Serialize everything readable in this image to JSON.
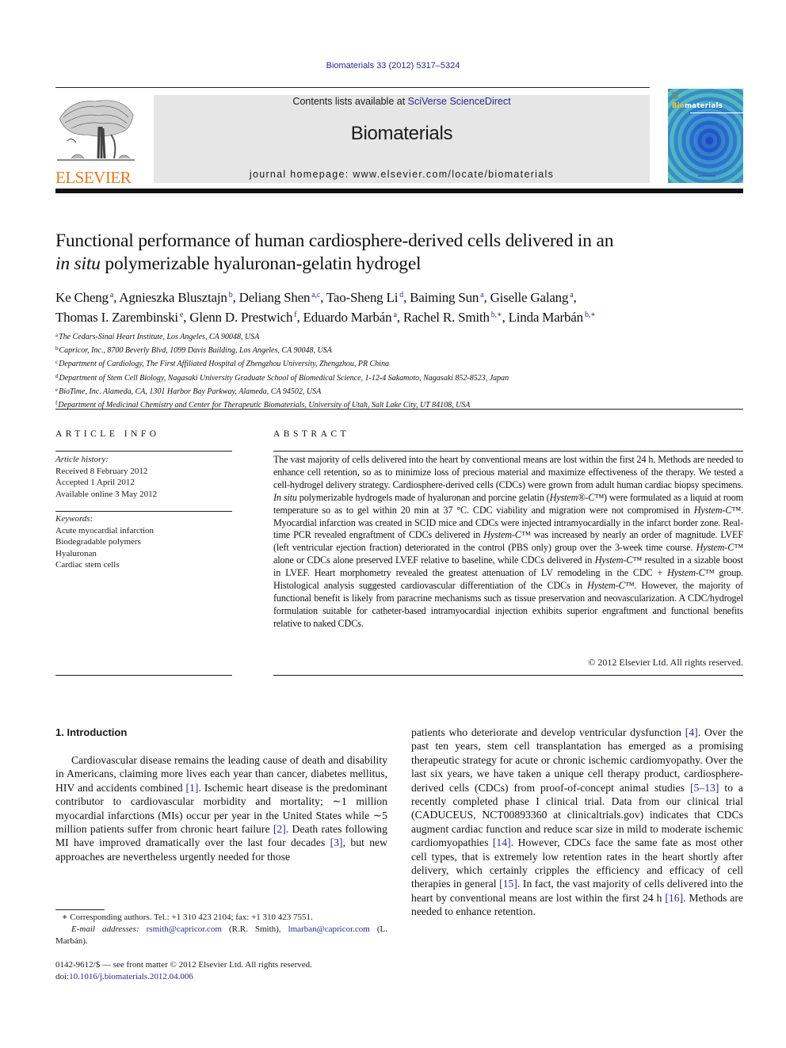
{
  "header": {
    "citation": "Biomaterials 33 (2012) 5317–5324",
    "contents_prefix": "Contents lists available at ",
    "contents_link": "SciVerse ScienceDirect",
    "journal_name": "Biomaterials",
    "homepage_prefix": "journal homepage: ",
    "homepage_url": "www.elsevier.com/locate/biomaterials",
    "publisher_logo_text": "ELSEVIER",
    "cover_title_highlight": "Bio",
    "cover_title_rest": "materials",
    "colors": {
      "publisher_orange": "#e87722",
      "link_blue": "#2a2a8a",
      "header_gray": "#e6e6e6"
    }
  },
  "article": {
    "title_line1": "Functional performance of human cardiosphere-derived cells delivered in an",
    "title_italic": "in situ",
    "title_line2_rest": " polymerizable hyaluronan-gelatin hydrogel",
    "authors": [
      {
        "name": "Ke Cheng",
        "sup": "a"
      },
      {
        "name": "Agnieszka Blusztajn",
        "sup": "b"
      },
      {
        "name": "Deliang Shen",
        "sup": "a,c"
      },
      {
        "name": "Tao-Sheng Li",
        "sup": "d"
      },
      {
        "name": "Baiming Sun",
        "sup": "a"
      },
      {
        "name": "Giselle Galang",
        "sup": "a"
      },
      {
        "name": "Thomas I. Zarembinski",
        "sup": "e"
      },
      {
        "name": "Glenn D. Prestwich",
        "sup": "f"
      },
      {
        "name": "Eduardo Marbán",
        "sup": "a"
      },
      {
        "name": "Rachel R. Smith",
        "sup": "b,∗"
      },
      {
        "name": "Linda Marbán",
        "sup": "b,∗"
      }
    ],
    "affiliations": [
      {
        "key": "a",
        "text": "The Cedars-Sinai Heart Institute, Los Angeles, CA 90048, USA"
      },
      {
        "key": "b",
        "text": "Capricor, Inc., 8700 Beverly Blvd, 1099 Davis Building, Los Angeles, CA 90048, USA"
      },
      {
        "key": "c",
        "text": "Department of Cardiology, The First Affiliated Hospital of Zhengzhou University, Zhengzhou, PR China"
      },
      {
        "key": "d",
        "text": "Department of Stem Cell Biology, Nagasaki University Graduate School of Biomedical Science, 1-12-4 Sakamoto, Nagasaki 852-8523, Japan"
      },
      {
        "key": "e",
        "text": "BioTime, Inc. Alameda, CA, 1301 Harbor Bay Parkway, Alameda, CA 94502, USA"
      },
      {
        "key": "f",
        "text": "Department of Medicinal Chemistry and Center for Therapeutic Biomaterials, University of Utah, Salt Lake City, UT 84108, USA"
      }
    ]
  },
  "article_info": {
    "heading": "ARTICLE INFO",
    "history_label": "Article history:",
    "received": "Received 8 February 2012",
    "accepted": "Accepted 1 April 2012",
    "online": "Available online 3 May 2012",
    "keywords_label": "Keywords:",
    "keywords": [
      "Acute myocardial infarction",
      "Biodegradable polymers",
      "Hyaluronan",
      "Cardiac stem cells"
    ]
  },
  "abstract": {
    "heading": "ABSTRACT",
    "segments": [
      {
        "t": "The vast majority of cells delivered into the heart by conventional means are lost within the first 24 h. Methods are needed to enhance cell retention, so as to minimize loss of precious material and maximize effectiveness of the therapy. We tested a cell-hydrogel delivery strategy. Cardiosphere-derived cells (CDCs) were grown from adult human cardiac biopsy specimens. "
      },
      {
        "t": "In situ",
        "i": true
      },
      {
        "t": " polymerizable hydrogels made of hyaluronan and porcine gelatin ("
      },
      {
        "t": "Hystem®-C™",
        "i": true
      },
      {
        "t": ") were formulated as a liquid at room temperature so as to gel within 20 min at 37 °C. CDC viability and migration were not compromised in "
      },
      {
        "t": "Hystem-C™",
        "i": true
      },
      {
        "t": ". Myocardial infarction was created in SCID mice and CDCs were injected intramyocardially in the infarct border zone. Real-time PCR revealed engraftment of CDCs delivered in "
      },
      {
        "t": "Hystem-C™",
        "i": true
      },
      {
        "t": " was increased by nearly an order of magnitude. LVEF (left ventricular ejection fraction) deteriorated in the control (PBS only) group over the 3-week time course. "
      },
      {
        "t": "Hystem-C™",
        "i": true
      },
      {
        "t": " alone or CDCs alone preserved LVEF relative to baseline, while CDCs delivered in "
      },
      {
        "t": "Hystem-C™",
        "i": true
      },
      {
        "t": " resulted in a sizable boost in LVEF. Heart morphometry revealed the greatest attenuation of LV remodeling in the CDC + "
      },
      {
        "t": "Hystem-C™",
        "i": true
      },
      {
        "t": " group. Histological analysis suggested cardiovascular differentiation of the CDCs in "
      },
      {
        "t": "Hystem-C™",
        "i": true
      },
      {
        "t": ". However, the majority of functional benefit is likely from paracrine mechanisms such as tissue preservation and neovascularization. A CDC/hydrogel formulation suitable for catheter-based intramyocardial injection exhibits superior engraftment and functional benefits relative to naked CDCs."
      }
    ],
    "copyright": "© 2012 Elsevier Ltd. All rights reserved."
  },
  "body": {
    "section_heading": "1.  Introduction",
    "left_segments": [
      {
        "t": "Cardiovascular disease remains the leading cause of death and disability in Americans, claiming more lives each year than cancer, diabetes mellitus, HIV and accidents combined "
      },
      {
        "t": "[1]",
        "ref": true
      },
      {
        "t": ". Ischemic heart disease is the predominant contributor to cardiovascular morbidity and mortality; ∼1 million myocardial infarctions (MIs) occur per year in the United States while ∼5 million patients suffer from chronic heart failure "
      },
      {
        "t": "[2]",
        "ref": true
      },
      {
        "t": ". Death rates following MI have improved dramatically over the last four decades "
      },
      {
        "t": "[3]",
        "ref": true
      },
      {
        "t": ", but new approaches are nevertheless urgently needed for those"
      }
    ],
    "right_segments": [
      {
        "t": "patients who deteriorate and develop ventricular dysfunction "
      },
      {
        "t": "[4]",
        "ref": true
      },
      {
        "t": ". Over the past ten years, stem cell transplantation has emerged as a promising therapeutic strategy for acute or chronic ischemic cardiomyopathy. Over the last six years, we have taken a unique cell therapy product, cardiosphere-derived cells (CDCs) from proof-of-concept animal studies "
      },
      {
        "t": "[5–13]",
        "ref": true
      },
      {
        "t": " to a recently completed phase I clinical trial. Data from our clinical trial (CADUCEUS, NCT00893360 at clinicaltrials.gov) indicates that CDCs augment cardiac function and reduce scar size in mild to moderate ischemic cardiomyopathies "
      },
      {
        "t": "[14]",
        "ref": true
      },
      {
        "t": ". However, CDCs face the same fate as most other cell types, that is extremely low retention rates in the heart shortly after delivery, which certainly cripples the efficiency and efficacy of cell therapies in general "
      },
      {
        "t": "[15]",
        "ref": true
      },
      {
        "t": ". In fact, the vast majority of cells delivered into the heart by conventional means are lost within the first 24 h "
      },
      {
        "t": "[16]",
        "ref": true
      },
      {
        "t": ". Methods are needed to enhance retention."
      }
    ]
  },
  "footnotes": {
    "corresponding": "∗ Corresponding authors. Tel.: +1 310 423 2104; fax: +1 310 423 7551.",
    "email_label": "E-mail addresses:",
    "email1": "rsmith@capricor.com",
    "email1_name": " (R.R. Smith), ",
    "email2": "lmarban@capricor.com",
    "email2_name": " (L. Marbán).",
    "front_matter": "0142-9612/$ — see front matter © 2012 Elsevier Ltd. All rights reserved.",
    "doi_prefix": "doi:",
    "doi": "10.1016/j.biomaterials.2012.04.006"
  }
}
